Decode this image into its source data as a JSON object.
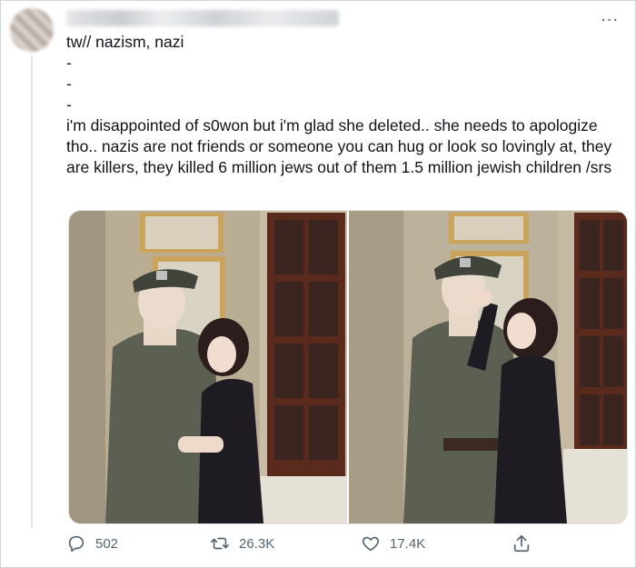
{
  "tweet": {
    "text": "tw// nazism, nazi\n-\n-\n-\ni'm disappointed of s0won but i'm glad she deleted.. she needs to apologize tho.. nazis are not friends or someone you can hug or look so lovingly at, they are killers, they killed 6 million jews out of them 1.5 million jewish children /srs",
    "more_icon": "..."
  },
  "actions": {
    "reply_count": "502",
    "retweet_count": "26.3K",
    "like_count": "17.4K"
  },
  "icons": {
    "reply": "reply-icon",
    "retweet": "retweet-icon",
    "like": "heart-icon",
    "share": "share-icon",
    "more": "more-icon"
  }
}
